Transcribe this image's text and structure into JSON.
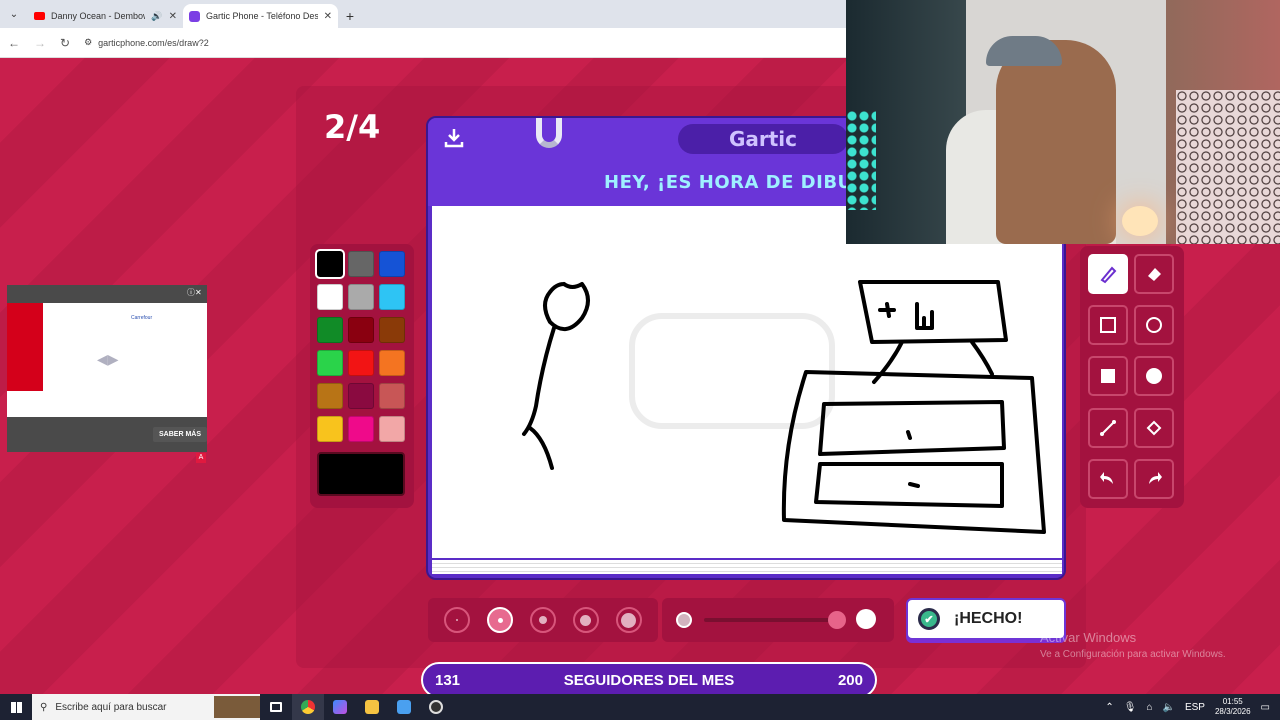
{
  "browser": {
    "tabs": [
      {
        "title": "Danny Ocean - Dembow (O",
        "favicon": "youtube-icon",
        "active": false
      },
      {
        "title": "Gartic Phone - Teléfono Descor",
        "favicon": "gartic-icon",
        "active": true
      }
    ],
    "url": "garticphone.com/es/draw?2"
  },
  "game": {
    "round": "2/4",
    "logo": "Gartic",
    "heading": "HEY, ¡ES HORA DE DIBU",
    "done_label": "¡HECHO!",
    "palette": [
      "#000000",
      "#666666",
      "#1553d6",
      "#ffffff",
      "#aaaaaa",
      "#2ec4f4",
      "#118b27",
      "#8a0010",
      "#8a3a08",
      "#2ad34a",
      "#f21414",
      "#f47421",
      "#b87416",
      "#8a0a40",
      "#c85656",
      "#f8c31d",
      "#ef0a8a",
      "#f2a7a7"
    ],
    "selected_color": "#000000",
    "selected_tool": "pencil"
  },
  "followers": {
    "current": "131",
    "label": "SEGUIDORES DEL MES",
    "goal": "200"
  },
  "watermark": {
    "title": "Activar Windows",
    "sub": "Ve a Configuración para activar Windows."
  },
  "ad": {
    "cta": "SABER MÁS",
    "brand": "Carrefour"
  },
  "taskbar": {
    "search_placeholder": "Escribe aquí para buscar",
    "lang": "ESP",
    "time": "01:55",
    "date": "28/3/2026"
  }
}
